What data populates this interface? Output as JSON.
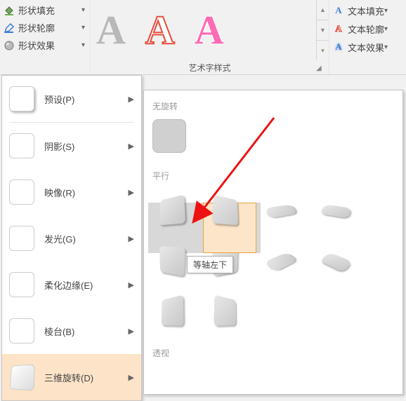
{
  "shape_panel": {
    "fill_label": "形状填充",
    "outline_label": "形状轮廓",
    "effects_label": "形状效果"
  },
  "text_panel": {
    "fill_label": "文本填充",
    "outline_label": "文本轮廓",
    "effects_label": "文本效果"
  },
  "wordart": {
    "title": "艺术字样式",
    "samples": [
      "A",
      "A",
      "A"
    ]
  },
  "effects_menu": [
    {
      "label": "预设(P)",
      "key": "preset"
    },
    {
      "label": "阴影(S)",
      "key": "shadow"
    },
    {
      "label": "映像(R)",
      "key": "reflection"
    },
    {
      "label": "发光(G)",
      "key": "glow"
    },
    {
      "label": "柔化边缘(E)",
      "key": "soft-edges"
    },
    {
      "label": "棱台(B)",
      "key": "bevel"
    },
    {
      "label": "三维旋转(D)",
      "key": "3d-rotation"
    }
  ],
  "submenu": {
    "no_rotation_label": "无旋转",
    "parallel_label": "平行",
    "perspective_label": "透视"
  },
  "tooltip_text": "等轴左下",
  "colors": {
    "highlight_bg": "#fde3c7",
    "accent_border": "#e8a33d"
  }
}
